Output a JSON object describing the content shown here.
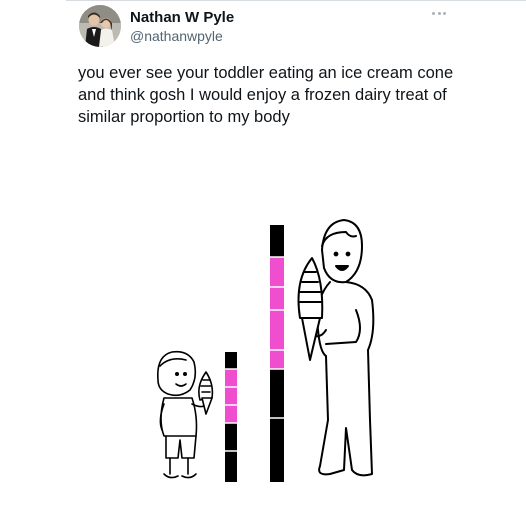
{
  "author": {
    "display_name": "Nathan W Pyle",
    "handle": "@nathanwpyle",
    "avatar_icon": "avatar-photo-icon"
  },
  "tweet": {
    "text": "you ever see your toddler eating an ice cream cone and think gosh I would enjoy a frozen dairy treat of similar proportion to my body",
    "more_icon": "more-options-icon"
  },
  "comic": {
    "bar_colors": {
      "black": "#000000",
      "pink": "#ef4fcf"
    }
  }
}
